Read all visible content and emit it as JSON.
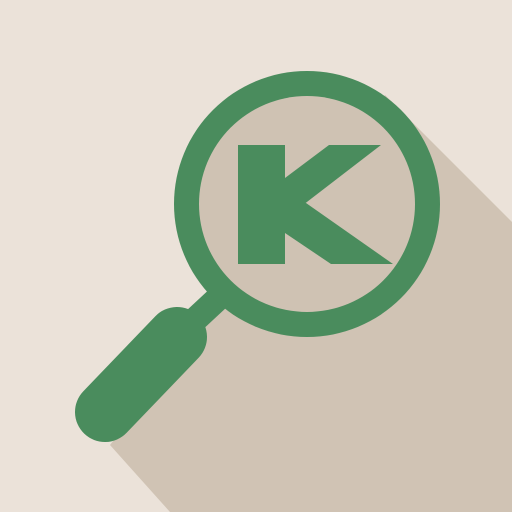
{
  "app_icon": {
    "name": "magnifying-glass-k-icon",
    "letter": "K",
    "colors": {
      "background": "#ebe2d9",
      "shadow": "#d0c3b4",
      "lens": "#cfc2b3",
      "green": "#4a8c5d"
    }
  }
}
